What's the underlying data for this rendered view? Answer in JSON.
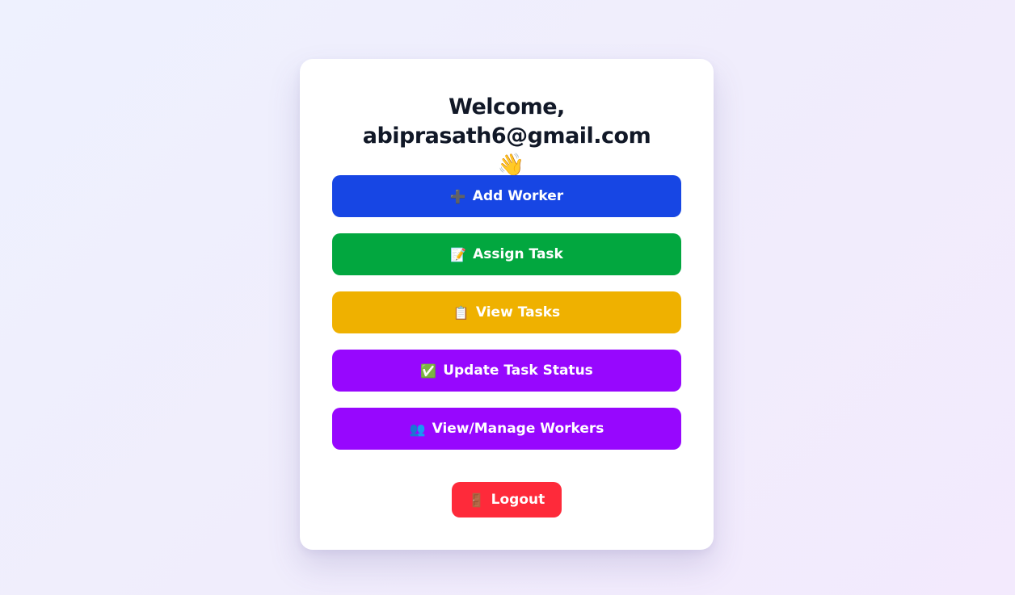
{
  "header": {
    "welcome_line1": "Welcome,",
    "welcome_line2": "abiprasath6@gmail.com",
    "wave_emoji": "👋"
  },
  "actions": [
    {
      "label": "Add Worker",
      "icon": "plus-icon",
      "glyph": "➕",
      "color": "#1746e4"
    },
    {
      "label": "Assign Task",
      "icon": "memo-icon",
      "glyph": "📝",
      "color": "#02a73f"
    },
    {
      "label": "View Tasks",
      "icon": "clipboard-icon",
      "glyph": "📋",
      "color": "#efb100"
    },
    {
      "label": "Update Task Status",
      "icon": "check-icon",
      "glyph": "✅",
      "color": "#9707fe"
    },
    {
      "label": "View/Manage Workers",
      "icon": "people-icon",
      "glyph": "👥",
      "color": "#9707fe"
    }
  ],
  "logout": {
    "label": "Logout",
    "icon": "door-icon",
    "glyph": "🚪",
    "color": "#fe2a3a"
  }
}
